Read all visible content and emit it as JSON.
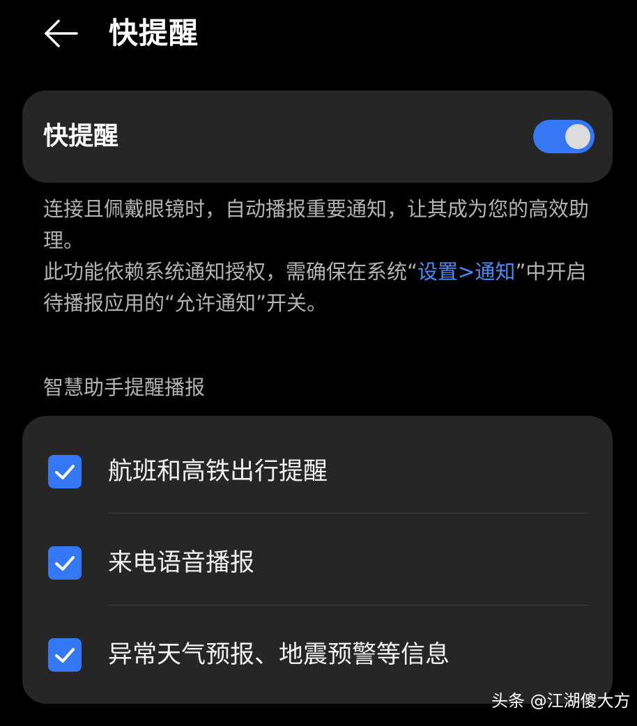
{
  "header": {
    "title": "快提醒",
    "back_icon": "arrow-left-icon"
  },
  "quick_reminder": {
    "label": "快提醒",
    "enabled": true,
    "switch_color": "#3478f6"
  },
  "description": {
    "line1": "连接且佩戴眼镜时，自动播报重要通知，让其成为您的高效助理。",
    "line2_before": "此功能依赖系统通知授权，需确保在系统“",
    "line2_link": "设置>通知",
    "line2_after": "”中开启待播报应用的“允许通知”开关。",
    "link_color": "#4a8df8"
  },
  "section": {
    "title": "智慧助手提醒播报"
  },
  "items": [
    {
      "label": "航班和高铁出行提醒",
      "checked": true
    },
    {
      "label": "来电语音播报",
      "checked": true
    },
    {
      "label": "异常天气预报、地震预警等信息",
      "checked": true
    }
  ],
  "watermark": {
    "text": "头条 @江湖傻大方"
  },
  "colors": {
    "background": "#000000",
    "card": "#262626",
    "accent": "#3478f6"
  }
}
